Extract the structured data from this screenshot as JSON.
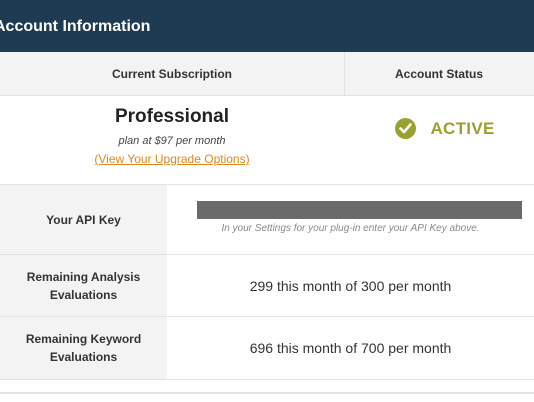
{
  "header": {
    "title": "Account Information"
  },
  "subscription": {
    "heading": "Current Subscription",
    "plan_name": "Professional",
    "plan_price": "plan at $97 per month",
    "upgrade_link": "(View Your Upgrade Options)"
  },
  "account_status": {
    "heading": "Account Status",
    "value": "ACTIVE",
    "icon": "check-circle-icon",
    "color": "#9aa12e"
  },
  "api_key": {
    "label": "Your API Key",
    "hint": "In your Settings for your plug-in enter your API Key above."
  },
  "analysis": {
    "label_line1": "Remaining Analysis",
    "label_line2": "Evaluations",
    "value": "299 this month of 300 per month"
  },
  "keyword": {
    "label_line1": "Remaining Keyword",
    "label_line2": "Evaluations",
    "value": "696 this month of 700 per month"
  },
  "colors": {
    "header_bg": "#1f3a53",
    "link": "#e0871a",
    "label_bg": "#f3f3f3"
  }
}
